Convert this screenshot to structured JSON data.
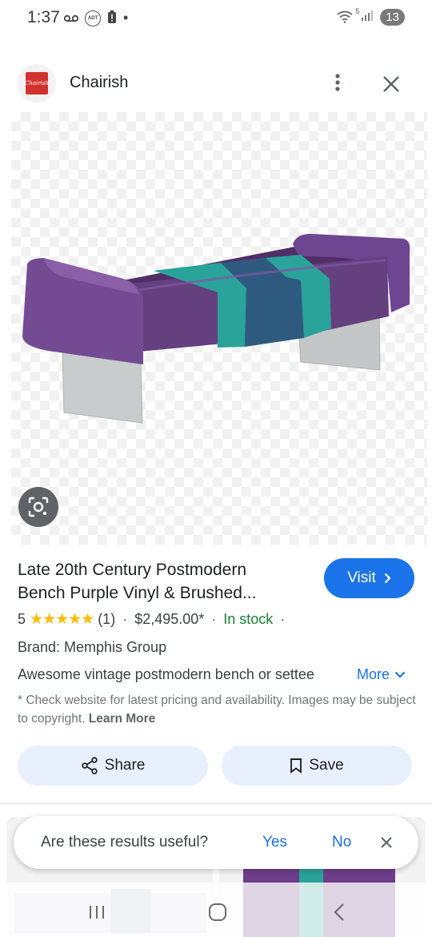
{
  "status_bar": {
    "time": "1:37",
    "icons": [
      "voicemail-icon",
      "adt-icon",
      "battery-alert-icon",
      "dot-icon"
    ],
    "adt_label": "ADT",
    "wifi_label": "5",
    "notification_count": "13"
  },
  "header": {
    "logo_text": "Chairish",
    "site_name": "Chairish"
  },
  "product": {
    "title_line1": "Late 20th Century Postmodern",
    "title_line2": "Bench Purple Vinyl & Brushed...",
    "visit_label": "Visit",
    "rating_value": "5",
    "stars": "★★★★★",
    "stars_count": 5,
    "review_count": "(1)",
    "separator": "·",
    "price": "$2,495.00*",
    "stock": "In stock",
    "brand": "Brand: Memphis Group",
    "description": "Awesome vintage postmodern bench or settee",
    "more_label": "More",
    "disclaimer": "* Check website for latest pricing and availability. Images may be subject to copyright.",
    "learn_more": "Learn More"
  },
  "actions": {
    "share_label": "Share",
    "save_label": "Save"
  },
  "feedback": {
    "question": "Are these results useful?",
    "yes": "Yes",
    "no": "No"
  },
  "colors": {
    "accent": "#1a73e8",
    "stock_green": "#188038",
    "star_yellow": "#fbbc04",
    "bench_purple": "#6b3f86",
    "bench_teal": "#2aa39a",
    "bench_blue": "#2f5a80",
    "button_bg": "#e8f0fe"
  }
}
